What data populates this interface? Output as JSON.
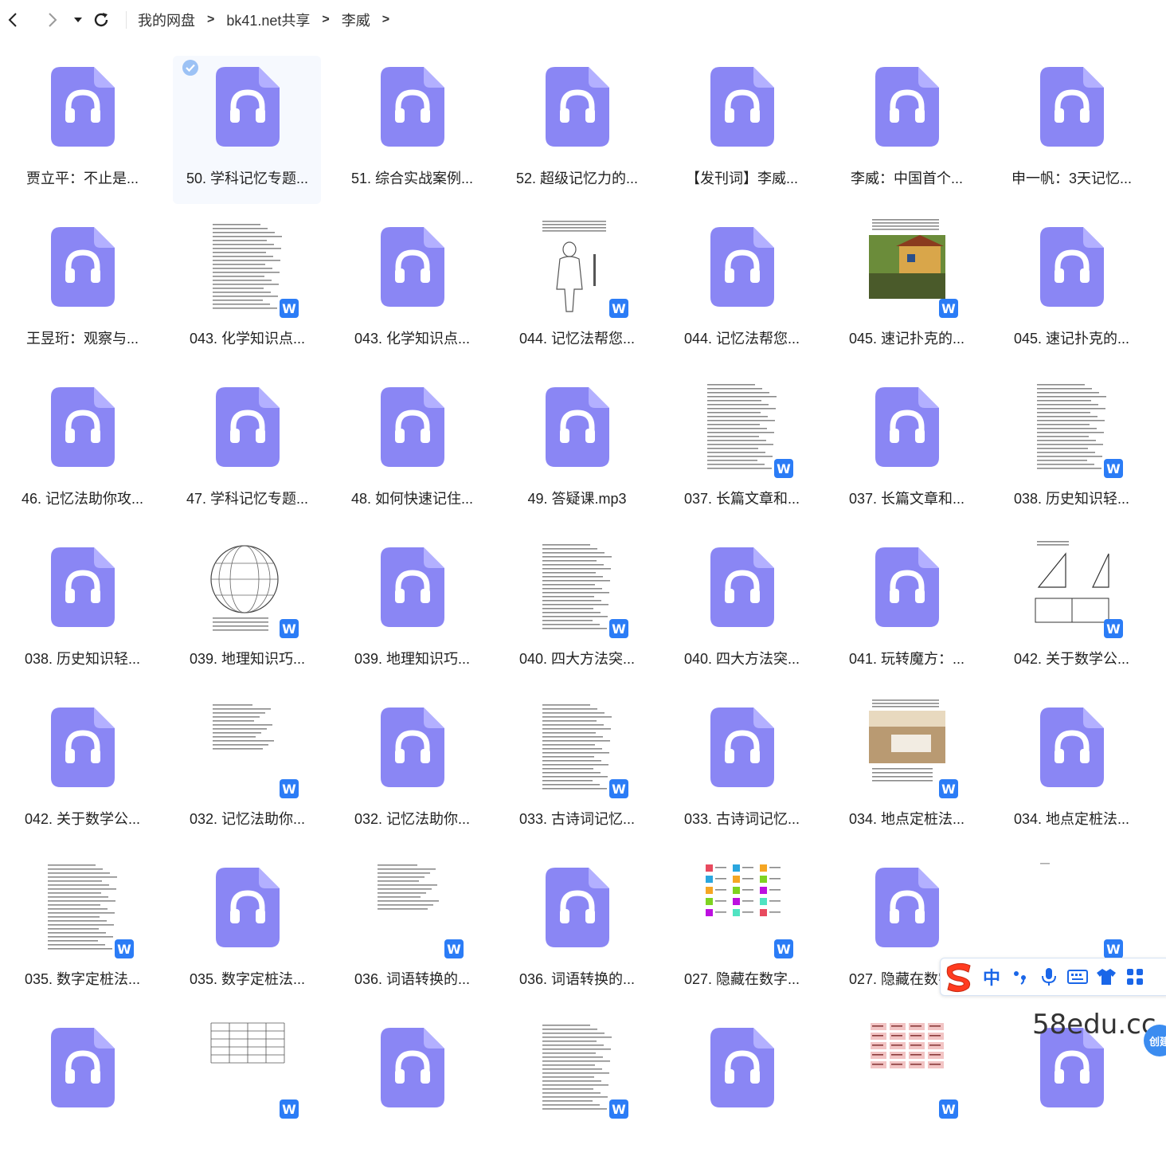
{
  "nav": {
    "back_icon": "chevron-left-icon",
    "forward_icon": "chevron-right-icon",
    "dropdown_icon": "caret-down-icon",
    "refresh_icon": "refresh-icon"
  },
  "breadcrumb": [
    "我的网盘",
    "bk41.net共享",
    "李威"
  ],
  "breadcrumb_separator": ">",
  "colors": {
    "audio_icon": "#8a86f4",
    "word_badge": "#2b7cf6",
    "accent": "#1a66e8"
  },
  "files": [
    {
      "name": "贾立平：不止是...",
      "type": "audio"
    },
    {
      "name": "50. 学科记忆专题...",
      "type": "audio",
      "selected": true
    },
    {
      "name": "51. 综合实战案例...",
      "type": "audio"
    },
    {
      "name": "52. 超级记忆力的...",
      "type": "audio"
    },
    {
      "name": "【发刊词】李威...",
      "type": "audio"
    },
    {
      "name": "李威：中国首个...",
      "type": "audio"
    },
    {
      "name": "申一帆：3天记忆...",
      "type": "audio"
    },
    {
      "name": "王昱珩：观察与...",
      "type": "audio"
    },
    {
      "name": "043. 化学知识点...",
      "type": "doc",
      "thumb": "text"
    },
    {
      "name": "043. 化学知识点...",
      "type": "audio"
    },
    {
      "name": "044. 记忆法帮您...",
      "type": "doc",
      "thumb": "body"
    },
    {
      "name": "044. 记忆法帮您...",
      "type": "audio"
    },
    {
      "name": "045. 速记扑克的...",
      "type": "doc",
      "thumb": "photo-house"
    },
    {
      "name": "045. 速记扑克的...",
      "type": "audio"
    },
    {
      "name": "46. 记忆法助你攻...",
      "type": "audio"
    },
    {
      "name": "47. 学科记忆专题...",
      "type": "audio"
    },
    {
      "name": "48. 如何快速记住...",
      "type": "audio"
    },
    {
      "name": "49. 答疑课.mp3",
      "type": "audio"
    },
    {
      "name": "037. 长篇文章和...",
      "type": "doc",
      "thumb": "text"
    },
    {
      "name": "037. 长篇文章和...",
      "type": "audio"
    },
    {
      "name": "038. 历史知识轻...",
      "type": "doc",
      "thumb": "text"
    },
    {
      "name": "038. 历史知识轻...",
      "type": "audio"
    },
    {
      "name": "039. 地理知识巧...",
      "type": "doc",
      "thumb": "globe"
    },
    {
      "name": "039. 地理知识巧...",
      "type": "audio"
    },
    {
      "name": "040. 四大方法突...",
      "type": "doc",
      "thumb": "text"
    },
    {
      "name": "040. 四大方法突...",
      "type": "audio"
    },
    {
      "name": "041. 玩转魔方：...",
      "type": "audio"
    },
    {
      "name": "042. 关于数学公...",
      "type": "doc",
      "thumb": "math"
    },
    {
      "name": "042. 关于数学公...",
      "type": "audio"
    },
    {
      "name": "032. 记忆法助你...",
      "type": "doc",
      "thumb": "text-short"
    },
    {
      "name": "032. 记忆法助你...",
      "type": "audio"
    },
    {
      "name": "033. 古诗词记忆...",
      "type": "doc",
      "thumb": "text"
    },
    {
      "name": "033. 古诗词记忆...",
      "type": "audio"
    },
    {
      "name": "034. 地点定桩法...",
      "type": "doc",
      "thumb": "photo-room"
    },
    {
      "name": "034. 地点定桩法...",
      "type": "audio"
    },
    {
      "name": "035. 数字定桩法...",
      "type": "doc",
      "thumb": "text"
    },
    {
      "name": "035. 数字定桩法...",
      "type": "audio"
    },
    {
      "name": "036. 词语转换的...",
      "type": "doc",
      "thumb": "text-short"
    },
    {
      "name": "036. 词语转换的...",
      "type": "audio"
    },
    {
      "name": "027. 隐藏在数字...",
      "type": "doc",
      "thumb": "icons"
    },
    {
      "name": "027. 隐藏在数字...",
      "type": "audio"
    },
    {
      "name": "",
      "type": "doc",
      "thumb": "blank"
    },
    {
      "name": "",
      "type": "audio"
    },
    {
      "name": "",
      "type": "doc",
      "thumb": "table"
    },
    {
      "name": "",
      "type": "audio"
    },
    {
      "name": "",
      "type": "doc",
      "thumb": "text"
    },
    {
      "name": "",
      "type": "audio"
    },
    {
      "name": "",
      "type": "doc",
      "thumb": "table-red"
    },
    {
      "name": "",
      "type": "audio"
    }
  ],
  "ime": {
    "logo_icon": "sogou-s-icon",
    "lang_label": "中",
    "items": [
      "punctuation-icon",
      "microphone-icon",
      "keyboard-icon",
      "skin-shirt-icon",
      "toolbox-grid-icon"
    ]
  },
  "watermark": "58edu.cc",
  "side_badge": "创建"
}
